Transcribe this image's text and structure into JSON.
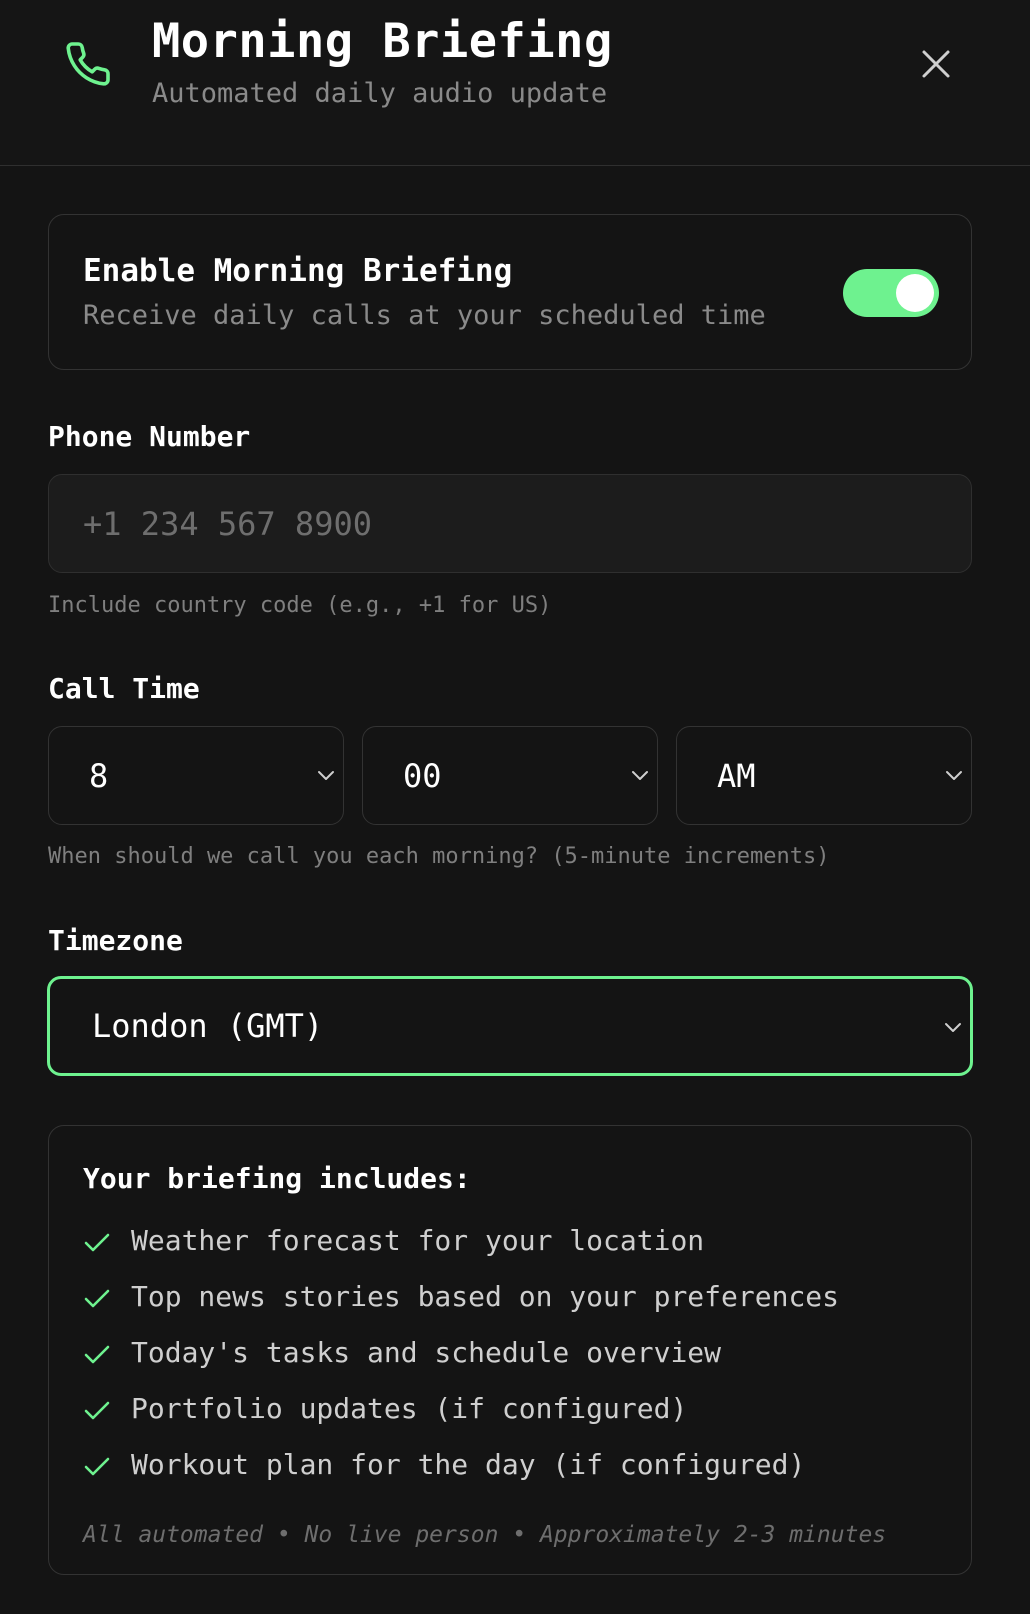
{
  "header": {
    "icon": "phone-icon",
    "title": "Morning Briefing",
    "subtitle": "Automated daily audio update",
    "close_icon": "close-icon"
  },
  "enable": {
    "title": "Enable Morning Briefing",
    "subtitle": "Receive daily calls at your scheduled time",
    "enabled": true
  },
  "phone": {
    "label": "Phone Number",
    "value": "",
    "placeholder": "+1 234 567 8900",
    "hint": "Include country code (e.g., +1 for US)"
  },
  "call_time": {
    "label": "Call Time",
    "hour": "8",
    "minute": "00",
    "period": "AM",
    "hint": "When should we call you each morning? (5-minute increments)"
  },
  "timezone": {
    "label": "Timezone",
    "value": "London (GMT)"
  },
  "includes": {
    "title": "Your briefing includes:",
    "items": [
      "Weather forecast for your location",
      "Top news stories based on your preferences",
      "Today's tasks and schedule overview",
      "Portfolio updates (if configured)",
      "Workout plan for the day (if configured)"
    ],
    "footer": "All automated • No live person • Approximately 2-3 minutes"
  },
  "colors": {
    "accent": "#6ef28f",
    "background": "#141414",
    "border": "#333333"
  }
}
